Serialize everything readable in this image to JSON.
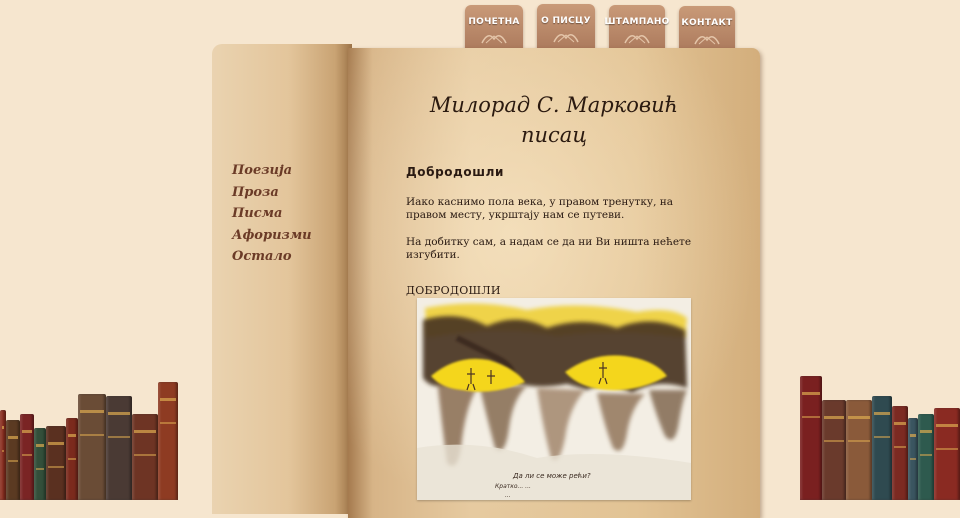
{
  "nav_tabs": [
    {
      "label": "ПОЧЕТНА"
    },
    {
      "label": "О ПИСЦУ"
    },
    {
      "label": "ШТАМПАНО"
    },
    {
      "label": "КОНТАКТ"
    }
  ],
  "book": {
    "title_line1": "Милорад  С. Марковић",
    "title_line2": "писац"
  },
  "left_menu": [
    {
      "label": "Поезија"
    },
    {
      "label": "Проза"
    },
    {
      "label": "Писма"
    },
    {
      "label": "Афоризми"
    },
    {
      "label": "Остало"
    }
  ],
  "content": {
    "heading": "Добродошли",
    "paragraph1": "Иако каснимо пола века, у правом тренутку, на правом месту, укрштају нам се путеви.",
    "paragraph2": "На добитку сам, а надам се да ни Ви ништа нећете изгубити.",
    "caps_heading": "ДОБРОДОШЛИ",
    "painting_caption": "Да ли се може рећи?",
    "painting_handwriting": [
      "Да ли се може рећи?",
      "Кратко... ...",
      "..."
    ]
  },
  "colors": {
    "background": "#f6e6cf",
    "tab": "#b5856a",
    "menu_text": "#6b3b27"
  },
  "icons": {
    "tab_ornament": "ornament-icon"
  }
}
